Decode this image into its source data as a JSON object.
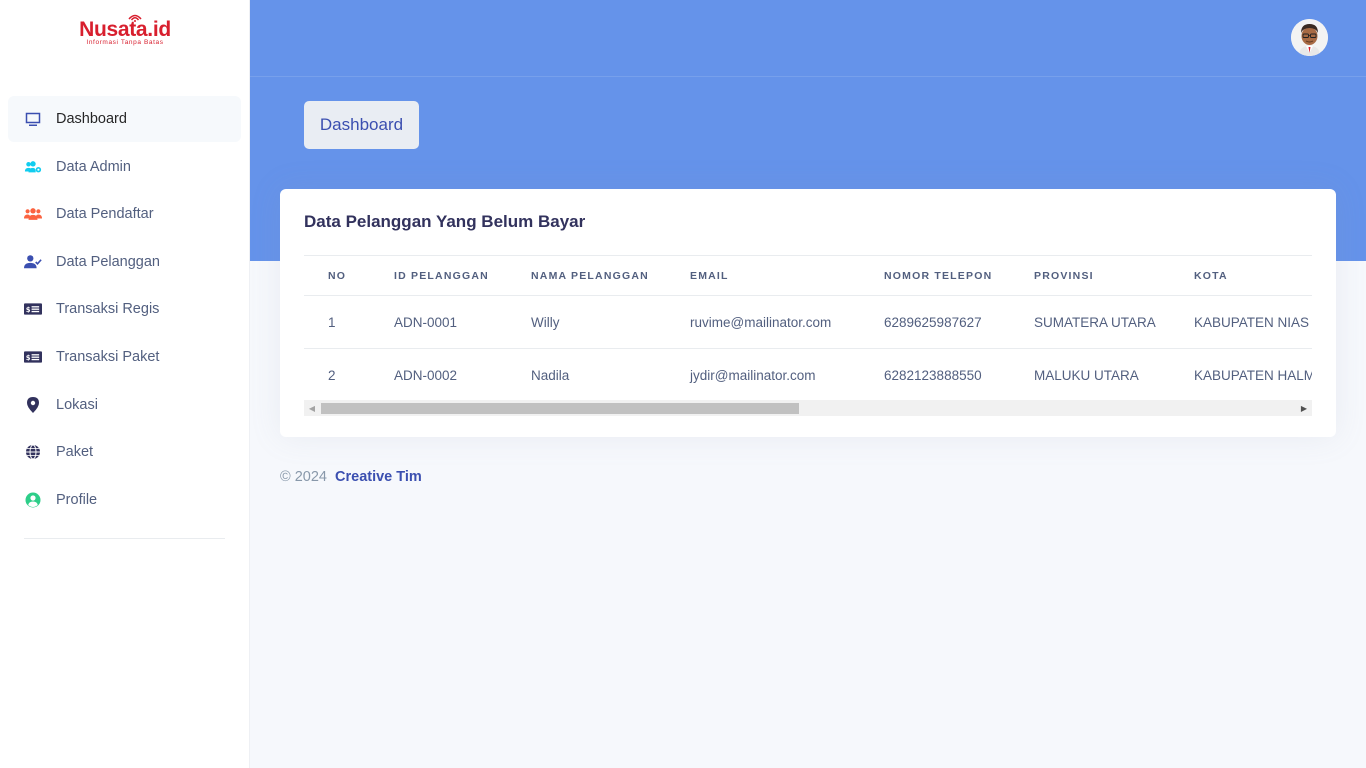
{
  "brand": {
    "name": "Nusata.id",
    "tagline": "Informasi Tanpa Batas",
    "color": "#d81f2e"
  },
  "sidebar": {
    "items": [
      {
        "label": "Dashboard",
        "icon": "monitor-icon",
        "color": "#3b4fb0",
        "active": true
      },
      {
        "label": "Data Admin",
        "icon": "users-cog-icon",
        "color": "#11cdef"
      },
      {
        "label": "Data Pendaftar",
        "icon": "users-icon",
        "color": "#fb6340"
      },
      {
        "label": "Data Pelanggan",
        "icon": "user-check-icon",
        "color": "#3b4fb0"
      },
      {
        "label": "Transaksi Regis",
        "icon": "money-bill-icon",
        "color": "#32325d"
      },
      {
        "label": "Transaksi Paket",
        "icon": "money-bill-icon",
        "color": "#32325d"
      },
      {
        "label": "Lokasi",
        "icon": "map-pin-icon",
        "color": "#32325d"
      },
      {
        "label": "Paket",
        "icon": "globe-icon",
        "color": "#32325d"
      },
      {
        "label": "Profile",
        "icon": "user-circle-icon",
        "color": "#2dce89"
      }
    ]
  },
  "header": {
    "breadcrumb_label": "Dashboard",
    "bg_color": "#6593ea"
  },
  "card": {
    "title": "Data Pelanggan Yang Belum Bayar",
    "columns": [
      "NO",
      "ID PELANGGAN",
      "NAMA PELANGGAN",
      "EMAIL",
      "NOMOR TELEPON",
      "PROVINSI",
      "KOTA"
    ],
    "rows": [
      [
        "1",
        "ADN-0001",
        "Willy",
        "ruvime@mailinator.com",
        "6289625987627",
        "SUMATERA UTARA",
        "KABUPATEN NIAS"
      ],
      [
        "2",
        "ADN-0002",
        "Nadila",
        "jydir@mailinator.com",
        "6282123888550",
        "MALUKU UTARA",
        "KABUPATEN HALMAHERA"
      ]
    ]
  },
  "footer": {
    "copyright": "© 2024",
    "link_label": "Creative Tim"
  }
}
